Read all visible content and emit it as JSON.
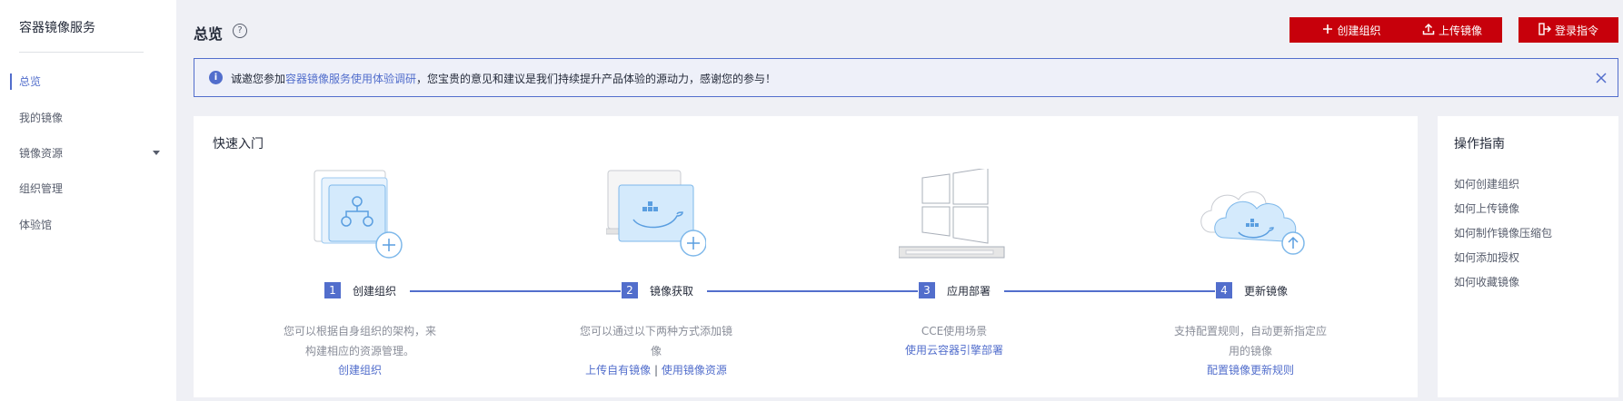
{
  "sidebar": {
    "title": "容器镜像服务",
    "items": [
      {
        "label": "总览"
      },
      {
        "label": "我的镜像"
      },
      {
        "label": "镜像资源"
      },
      {
        "label": "组织管理"
      },
      {
        "label": "体验馆"
      }
    ]
  },
  "header": {
    "title": "总览",
    "help_icon": "?",
    "buttons": {
      "create_org": "创建组织",
      "upload_image": "上传镜像",
      "login_cmd": "登录指令"
    }
  },
  "banner": {
    "text_prefix": "诚邀您参加",
    "link": "容器镜像服务使用体验调研",
    "text_suffix": "，您宝贵的意见和建议是我们持续提升产品体验的源动力，感谢您的参与！"
  },
  "quickstart": {
    "title": "快速入门",
    "steps": [
      {
        "num": "1",
        "label": "创建组织",
        "desc": "您可以根据自身组织的架构，来构建相应的资源管理。",
        "links": [
          "创建组织"
        ]
      },
      {
        "num": "2",
        "label": "镜像获取",
        "desc": "您可以通过以下两种方式添加镜像",
        "links": [
          "上传自有镜像",
          "使用镜像资源"
        ],
        "separator": "|"
      },
      {
        "num": "3",
        "label": "应用部署",
        "desc": "CCE使用场景",
        "links": [
          "使用云容器引擎部署"
        ]
      },
      {
        "num": "4",
        "label": "更新镜像",
        "desc": "支持配置规则，自动更新指定应用的镜像",
        "links": [
          "配置镜像更新规则"
        ]
      }
    ]
  },
  "guide": {
    "title": "操作指南",
    "links": [
      "如何创建组织",
      "如何上传镜像",
      "如何制作镜像压缩包",
      "如何添加授权",
      "如何收藏镜像"
    ]
  },
  "colors": {
    "brand_red": "#c7000b",
    "accent_blue": "#526ecc"
  }
}
